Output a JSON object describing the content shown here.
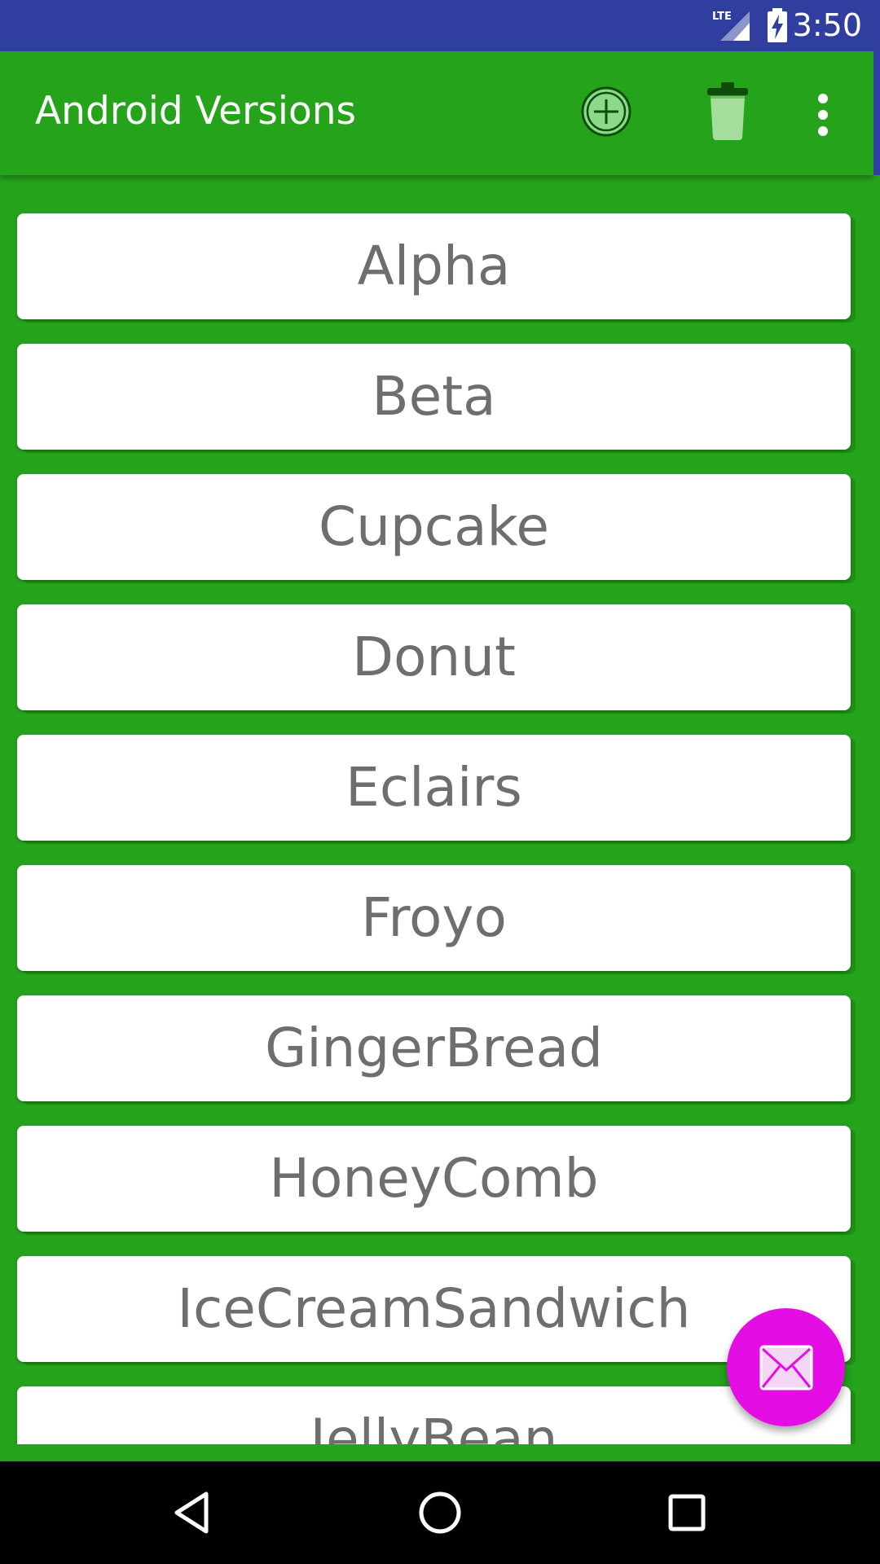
{
  "status_bar": {
    "time": "3:50",
    "network": "LTE",
    "signal_icon": "lte-signal-icon",
    "battery_icon": "battery-charging-icon"
  },
  "app_bar": {
    "title": "Android Versions",
    "actions": [
      {
        "name": "add",
        "icon": "add-circle-icon"
      },
      {
        "name": "delete",
        "icon": "trash-icon"
      },
      {
        "name": "more",
        "icon": "overflow-menu-icon"
      }
    ]
  },
  "list": {
    "items": [
      "Alpha",
      "Beta",
      "Cupcake",
      "Donut",
      "Eclairs",
      "Froyo",
      "GingerBread",
      "HoneyComb",
      "IceCreamSandwich",
      "JellyBean"
    ]
  },
  "fab": {
    "icon": "mail-icon"
  },
  "nav_bar": {
    "buttons": [
      "back-icon",
      "home-icon",
      "recent-apps-icon"
    ]
  },
  "colors": {
    "status_bar": "#303f9f",
    "primary": "#25a31b",
    "fab": "#e40ee4",
    "item_text": "#6e6e6e",
    "nav_bar": "#000000"
  }
}
